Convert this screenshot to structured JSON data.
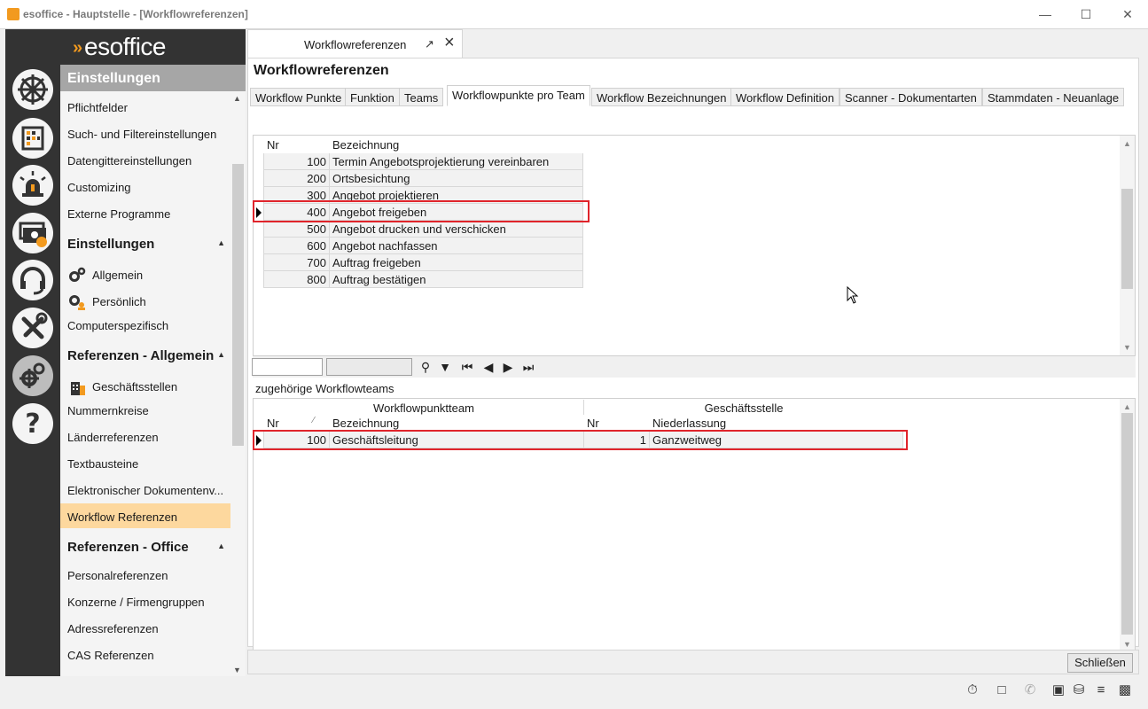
{
  "window": {
    "title": "esoffice - Hauptstelle - [Workflowreferenzen]"
  },
  "logo": {
    "text": "esoffice"
  },
  "sidebar": {
    "header": "Einstellungen",
    "items_top": [
      "Pflichtfelder",
      "Such- und Filtereinstellungen",
      "Datengittereinstellungen",
      "Customizing",
      "Externe Programme"
    ],
    "sec_einstellungen": "Einstellungen",
    "items_einst": [
      "Allgemein",
      "Persönlich",
      "Computerspezifisch"
    ],
    "sec_ref_allg": "Referenzen - Allgemein",
    "items_ref_allg": [
      "Geschäftsstellen",
      "Nummernkreise",
      "Länderreferenzen",
      "Textbausteine",
      "Elektronischer Dokumentenv...",
      "Workflow Referenzen"
    ],
    "sec_ref_office": "Referenzen - Office",
    "items_ref_office": [
      "Personalreferenzen",
      "Konzerne / Firmengruppen",
      "Adressreferenzen",
      "CAS Referenzen"
    ]
  },
  "doctab": {
    "label": "Workflowreferenzen"
  },
  "panel": {
    "title": "Workflowreferenzen",
    "tabs": [
      "Workflow Punkte",
      "Funktion",
      "Teams",
      "Workflowpunkte pro Team",
      "Workflow Bezeichnungen",
      "Workflow Definition",
      "Scanner - Dokumentarten",
      "Stammdaten - Neuanlage"
    ],
    "selected_tab": "Workflowpunkte pro Team"
  },
  "grid1": {
    "col_nr": "Nr",
    "col_bez": "Bezeichnung",
    "rows": [
      {
        "nr": "100",
        "bez": "Termin Angebotsprojektierung vereinbaren"
      },
      {
        "nr": "200",
        "bez": "Ortsbesichtung"
      },
      {
        "nr": "300",
        "bez": "Angebot projektieren"
      },
      {
        "nr": "400",
        "bez": "Angebot freigeben"
      },
      {
        "nr": "500",
        "bez": "Angebot drucken und verschicken"
      },
      {
        "nr": "600",
        "bez": "Angebot nachfassen"
      },
      {
        "nr": "700",
        "bez": "Auftrag freigeben"
      },
      {
        "nr": "800",
        "bez": "Auftrag bestätigen"
      }
    ],
    "selected_row": 3
  },
  "subheading": "zugehörige Workflowteams",
  "grid2": {
    "group1": "Workflowpunktteam",
    "group2": "Geschäftsstelle",
    "col_nr": "Nr",
    "sort_mark": "⁄",
    "col_bez": "Bezeichnung",
    "col_nr2": "Nr",
    "col_nl": "Niederlassung",
    "row": {
      "nr": "100",
      "bez": "Geschäftsleitung",
      "nr2": "1",
      "nl": "Ganzweitweg"
    }
  },
  "footer": {
    "close_label": "Schließen"
  },
  "colors": {
    "accent": "#f29a1f",
    "highlight": "#fdd89e",
    "rail": "#333333",
    "redbox": "#e0242b"
  }
}
